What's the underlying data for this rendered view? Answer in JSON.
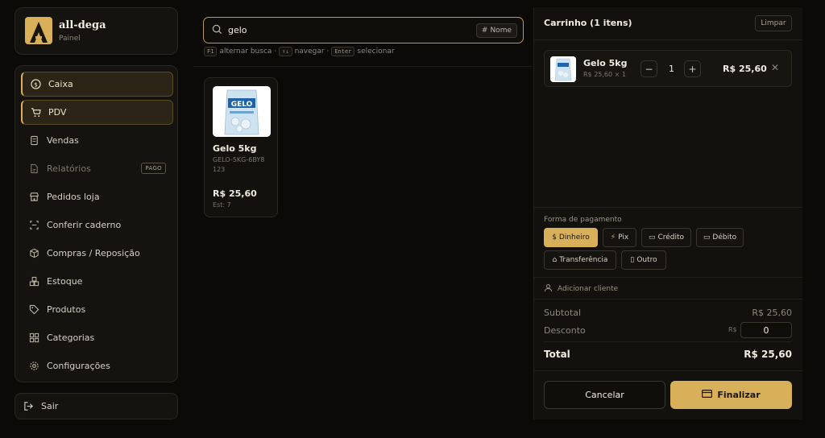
{
  "brand": {
    "name": "all-dega",
    "subtitle": "Painel"
  },
  "sidebar": {
    "items": [
      {
        "label": "Caixa",
        "icon": "dollar-circle-icon",
        "active": true
      },
      {
        "label": "PDV",
        "icon": "cart-icon",
        "active": true
      },
      {
        "label": "Vendas",
        "icon": "receipt-icon"
      },
      {
        "label": "Relatórios",
        "icon": "file-icon",
        "badge": "PAGO",
        "dim": true
      },
      {
        "label": "Pedidos loja",
        "icon": "store-icon"
      },
      {
        "label": "Conferir caderno",
        "icon": "scan-icon"
      },
      {
        "label": "Compras / Reposição",
        "icon": "box-icon"
      },
      {
        "label": "Estoque",
        "icon": "boxes-icon"
      },
      {
        "label": "Produtos",
        "icon": "tag-icon"
      },
      {
        "label": "Categorias",
        "icon": "grid-icon"
      },
      {
        "label": "Configurações",
        "icon": "gear-icon"
      }
    ],
    "logout": "Sair"
  },
  "search": {
    "value": "gelo",
    "mode": "Nome",
    "hints": [
      {
        "key": "F1",
        "text": "alternar busca ·"
      },
      {
        "key": "↑↓",
        "text": "navegar ·"
      },
      {
        "key": "Enter",
        "text": "selecionar"
      }
    ]
  },
  "products": [
    {
      "name": "Gelo 5kg",
      "sku": "GELO-5KG-6BY8",
      "code": "123",
      "price": "R$ 25,60",
      "stock": "Est: 7",
      "image_text": "GELO"
    }
  ],
  "cart": {
    "title": "Carrinho (1 itens)",
    "clear": "Limpar",
    "items": [
      {
        "name": "Gelo 5kg",
        "sub": "R$ 25,60 × 1",
        "qty": "1",
        "total": "R$ 25,60"
      }
    ],
    "payment_label": "Forma de pagamento",
    "payments": [
      {
        "label": "Dinheiro",
        "icon": "cash-icon",
        "selected": true
      },
      {
        "label": "Pix",
        "icon": "lightning-icon"
      },
      {
        "label": "Crédito",
        "icon": "credit-card-icon"
      },
      {
        "label": "Débito",
        "icon": "debit-card-icon"
      },
      {
        "label": "Transferência",
        "icon": "bank-icon"
      },
      {
        "label": "Outro",
        "icon": "document-icon"
      }
    ],
    "add_client": "Adicionar cliente",
    "subtotal_label": "Subtotal",
    "subtotal": "R$ 25,60",
    "discount_label": "Desconto",
    "discount_currency": "R$",
    "discount": "0",
    "total_label": "Total",
    "total": "R$ 25,60",
    "cancel": "Cancelar",
    "finish": "Finalizar"
  },
  "colors": {
    "accent": "#d8b05a",
    "background": "#0b0a08",
    "panel": "#15130f"
  }
}
